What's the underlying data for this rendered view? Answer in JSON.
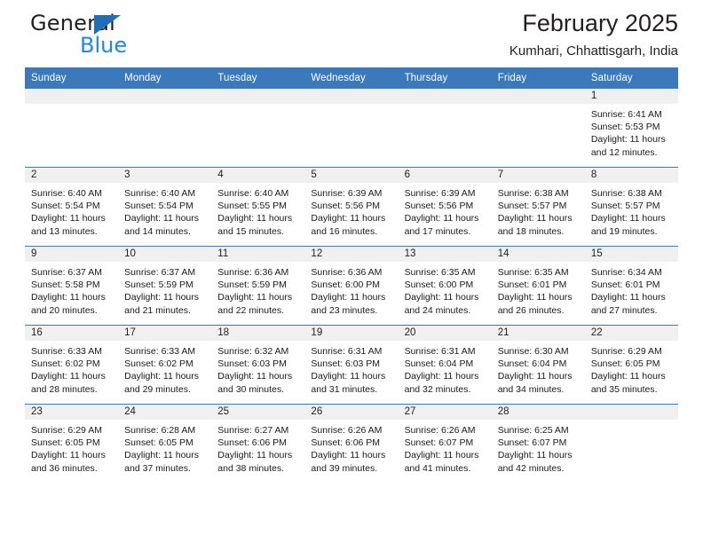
{
  "brand": {
    "name_part1": "General",
    "name_part2": "Blue"
  },
  "header": {
    "title": "February 2025",
    "subtitle": "Kumhari, Chhattisgarh, India"
  },
  "colors": {
    "header_blue": "#3b79ba",
    "brand_blue": "#1f8ad6",
    "brand_triangle": "#1f6fb8",
    "daynum_band": "#f0f0f0"
  },
  "weekday_headers": [
    "Sunday",
    "Monday",
    "Tuesday",
    "Wednesday",
    "Thursday",
    "Friday",
    "Saturday"
  ],
  "labels": {
    "sunrise_prefix": "Sunrise:",
    "sunset_prefix": "Sunset:",
    "daylight_prefix": "Daylight:"
  },
  "weeks": [
    [
      {
        "day": "",
        "lines": []
      },
      {
        "day": "",
        "lines": []
      },
      {
        "day": "",
        "lines": []
      },
      {
        "day": "",
        "lines": []
      },
      {
        "day": "",
        "lines": []
      },
      {
        "day": "",
        "lines": []
      },
      {
        "day": "1",
        "lines": [
          "Sunrise: 6:41 AM",
          "Sunset: 5:53 PM",
          "Daylight: 11 hours",
          "and 12 minutes."
        ]
      }
    ],
    [
      {
        "day": "2",
        "lines": [
          "Sunrise: 6:40 AM",
          "Sunset: 5:54 PM",
          "Daylight: 11 hours",
          "and 13 minutes."
        ]
      },
      {
        "day": "3",
        "lines": [
          "Sunrise: 6:40 AM",
          "Sunset: 5:54 PM",
          "Daylight: 11 hours",
          "and 14 minutes."
        ]
      },
      {
        "day": "4",
        "lines": [
          "Sunrise: 6:40 AM",
          "Sunset: 5:55 PM",
          "Daylight: 11 hours",
          "and 15 minutes."
        ]
      },
      {
        "day": "5",
        "lines": [
          "Sunrise: 6:39 AM",
          "Sunset: 5:56 PM",
          "Daylight: 11 hours",
          "and 16 minutes."
        ]
      },
      {
        "day": "6",
        "lines": [
          "Sunrise: 6:39 AM",
          "Sunset: 5:56 PM",
          "Daylight: 11 hours",
          "and 17 minutes."
        ]
      },
      {
        "day": "7",
        "lines": [
          "Sunrise: 6:38 AM",
          "Sunset: 5:57 PM",
          "Daylight: 11 hours",
          "and 18 minutes."
        ]
      },
      {
        "day": "8",
        "lines": [
          "Sunrise: 6:38 AM",
          "Sunset: 5:57 PM",
          "Daylight: 11 hours",
          "and 19 minutes."
        ]
      }
    ],
    [
      {
        "day": "9",
        "lines": [
          "Sunrise: 6:37 AM",
          "Sunset: 5:58 PM",
          "Daylight: 11 hours",
          "and 20 minutes."
        ]
      },
      {
        "day": "10",
        "lines": [
          "Sunrise: 6:37 AM",
          "Sunset: 5:59 PM",
          "Daylight: 11 hours",
          "and 21 minutes."
        ]
      },
      {
        "day": "11",
        "lines": [
          "Sunrise: 6:36 AM",
          "Sunset: 5:59 PM",
          "Daylight: 11 hours",
          "and 22 minutes."
        ]
      },
      {
        "day": "12",
        "lines": [
          "Sunrise: 6:36 AM",
          "Sunset: 6:00 PM",
          "Daylight: 11 hours",
          "and 23 minutes."
        ]
      },
      {
        "day": "13",
        "lines": [
          "Sunrise: 6:35 AM",
          "Sunset: 6:00 PM",
          "Daylight: 11 hours",
          "and 24 minutes."
        ]
      },
      {
        "day": "14",
        "lines": [
          "Sunrise: 6:35 AM",
          "Sunset: 6:01 PM",
          "Daylight: 11 hours",
          "and 26 minutes."
        ]
      },
      {
        "day": "15",
        "lines": [
          "Sunrise: 6:34 AM",
          "Sunset: 6:01 PM",
          "Daylight: 11 hours",
          "and 27 minutes."
        ]
      }
    ],
    [
      {
        "day": "16",
        "lines": [
          "Sunrise: 6:33 AM",
          "Sunset: 6:02 PM",
          "Daylight: 11 hours",
          "and 28 minutes."
        ]
      },
      {
        "day": "17",
        "lines": [
          "Sunrise: 6:33 AM",
          "Sunset: 6:02 PM",
          "Daylight: 11 hours",
          "and 29 minutes."
        ]
      },
      {
        "day": "18",
        "lines": [
          "Sunrise: 6:32 AM",
          "Sunset: 6:03 PM",
          "Daylight: 11 hours",
          "and 30 minutes."
        ]
      },
      {
        "day": "19",
        "lines": [
          "Sunrise: 6:31 AM",
          "Sunset: 6:03 PM",
          "Daylight: 11 hours",
          "and 31 minutes."
        ]
      },
      {
        "day": "20",
        "lines": [
          "Sunrise: 6:31 AM",
          "Sunset: 6:04 PM",
          "Daylight: 11 hours",
          "and 32 minutes."
        ]
      },
      {
        "day": "21",
        "lines": [
          "Sunrise: 6:30 AM",
          "Sunset: 6:04 PM",
          "Daylight: 11 hours",
          "and 34 minutes."
        ]
      },
      {
        "day": "22",
        "lines": [
          "Sunrise: 6:29 AM",
          "Sunset: 6:05 PM",
          "Daylight: 11 hours",
          "and 35 minutes."
        ]
      }
    ],
    [
      {
        "day": "23",
        "lines": [
          "Sunrise: 6:29 AM",
          "Sunset: 6:05 PM",
          "Daylight: 11 hours",
          "and 36 minutes."
        ]
      },
      {
        "day": "24",
        "lines": [
          "Sunrise: 6:28 AM",
          "Sunset: 6:05 PM",
          "Daylight: 11 hours",
          "and 37 minutes."
        ]
      },
      {
        "day": "25",
        "lines": [
          "Sunrise: 6:27 AM",
          "Sunset: 6:06 PM",
          "Daylight: 11 hours",
          "and 38 minutes."
        ]
      },
      {
        "day": "26",
        "lines": [
          "Sunrise: 6:26 AM",
          "Sunset: 6:06 PM",
          "Daylight: 11 hours",
          "and 39 minutes."
        ]
      },
      {
        "day": "27",
        "lines": [
          "Sunrise: 6:26 AM",
          "Sunset: 6:07 PM",
          "Daylight: 11 hours",
          "and 41 minutes."
        ]
      },
      {
        "day": "28",
        "lines": [
          "Sunrise: 6:25 AM",
          "Sunset: 6:07 PM",
          "Daylight: 11 hours",
          "and 42 minutes."
        ]
      },
      {
        "day": "",
        "lines": []
      }
    ]
  ]
}
